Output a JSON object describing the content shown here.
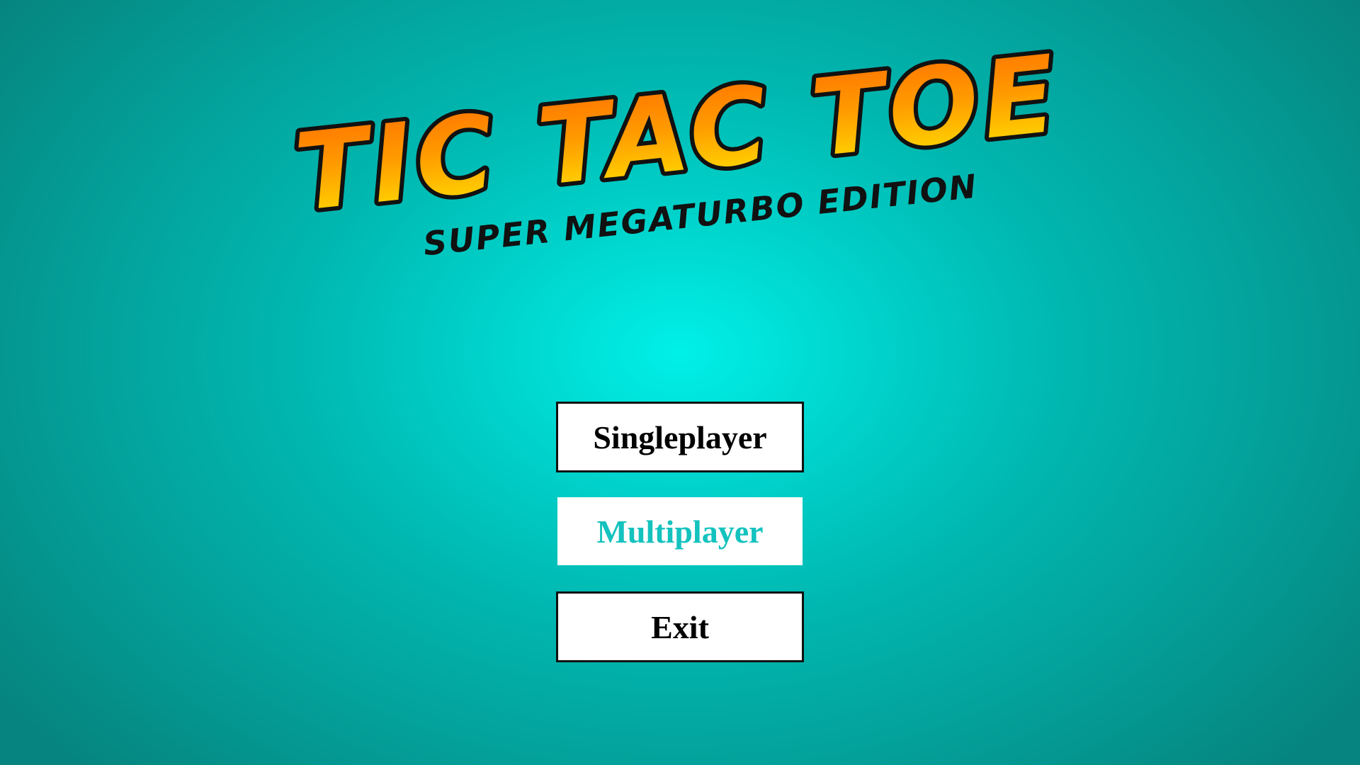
{
  "logo": {
    "title": "TIC TAC TOE",
    "subtitle": "SUPER MEGATURBO EDITION"
  },
  "menu": {
    "singleplayer": "Singleplayer",
    "multiplayer": "Multiplayer",
    "exit": "Exit"
  },
  "colors": {
    "background_center": "#00f0e8",
    "background_edge": "#06847f",
    "logo_fill_top": "#ff7a00",
    "logo_fill_bottom": "#ffe600",
    "logo_outline": "#111111",
    "button_bg": "#ffffff",
    "button_text": "#000000",
    "button_hover_text": "#14c2be"
  }
}
